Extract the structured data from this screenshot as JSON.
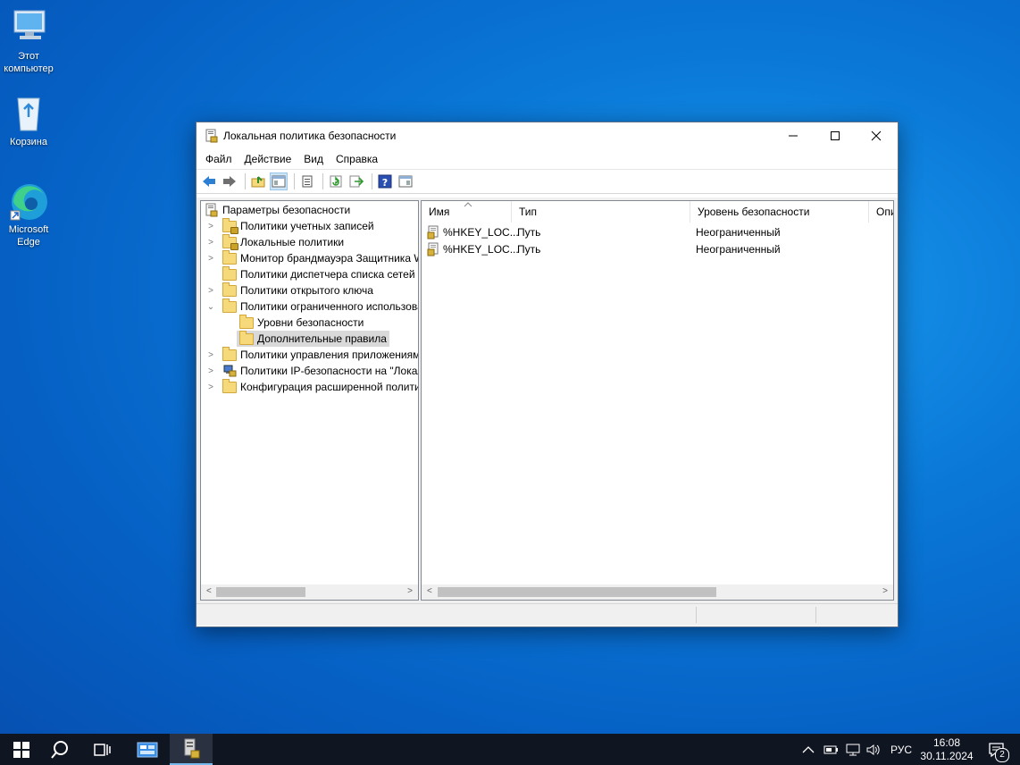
{
  "desktop": {
    "icons": [
      {
        "label": "Этот компьютер",
        "icon": "computer-icon"
      },
      {
        "label": "Корзина",
        "icon": "recycle-bin-icon"
      },
      {
        "label": "Microsoft Edge",
        "icon": "edge-icon"
      }
    ]
  },
  "window": {
    "title": "Локальная политика безопасности",
    "menu": [
      "Файл",
      "Действие",
      "Вид",
      "Справка"
    ],
    "toolbar": [
      "back-icon",
      "forward-icon",
      "up-folder-icon",
      "show-hide-tree-icon",
      "properties-icon",
      "refresh-icon",
      "export-list-icon",
      "help-icon",
      "console-icon"
    ],
    "tree": {
      "root": "Параметры безопасности",
      "items": [
        "Политики учетных записей",
        "Локальные политики",
        "Монитор брандмауэра Защитника Windows в режиме повышенной безопасности",
        "Политики диспетчера списка сетей",
        "Политики открытого ключа",
        "Политики ограниченного использования программ",
        "Уровни безопасности",
        "Дополнительные правила",
        "Политики управления приложениями",
        "Политики IP-безопасности на \"Локальный компьютер\"",
        "Конфигурация расширенной политики аудита"
      ]
    },
    "list": {
      "columns": [
        "Имя",
        "Тип",
        "Уровень безопасности",
        "Описание"
      ],
      "rows": [
        {
          "name": "%HKEY_LOC...",
          "type": "Путь",
          "level": "Неограниченный"
        },
        {
          "name": "%HKEY_LOC...",
          "type": "Путь",
          "level": "Неограниченный"
        }
      ]
    }
  },
  "taskbar": {
    "language": "РУС",
    "time": "16:08",
    "date": "30.11.2024",
    "notifications": "2"
  }
}
